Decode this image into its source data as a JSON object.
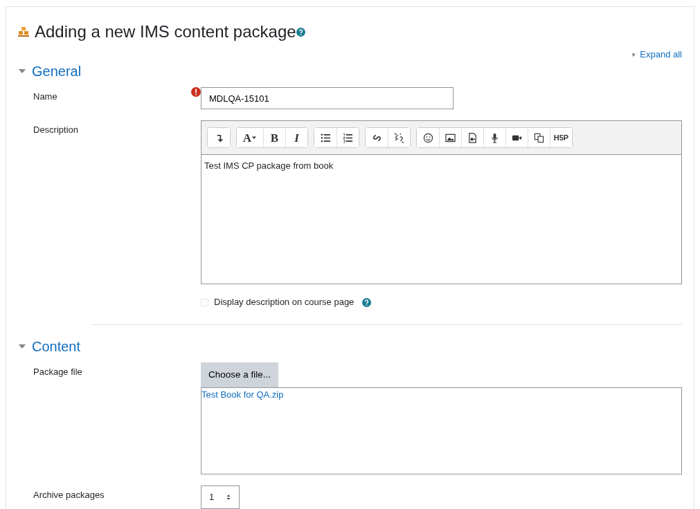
{
  "page": {
    "title": "Adding a new IMS content package",
    "expand_all": "Expand all"
  },
  "sections": [
    {
      "title": "General",
      "expanded": true,
      "fields": [
        {
          "kind": "text",
          "label": "Name",
          "required": true,
          "value": "MDLQA-15101"
        },
        {
          "kind": "editor",
          "label": "Description",
          "value": "Test IMS CP package from book",
          "toolbar": [
            [
              {
                "kind": "collapse"
              }
            ],
            [
              {
                "kind": "font",
                "text": "A"
              },
              {
                "kind": "bold",
                "text": "B"
              },
              {
                "kind": "italic",
                "text": "I"
              }
            ],
            [
              {
                "kind": "ul"
              },
              {
                "kind": "ol"
              }
            ],
            [
              {
                "kind": "link"
              },
              {
                "kind": "unlink"
              }
            ],
            [
              {
                "kind": "emoji"
              },
              {
                "kind": "image"
              },
              {
                "kind": "media"
              },
              {
                "kind": "mic"
              },
              {
                "kind": "video"
              },
              {
                "kind": "copy"
              },
              {
                "kind": "h5p",
                "text": "H5P"
              }
            ]
          ],
          "checkbox": {
            "label": "Display description on course page",
            "checked": false
          }
        }
      ]
    },
    {
      "title": "Content",
      "expanded": true,
      "fields": [
        {
          "kind": "file",
          "label": "Package file",
          "button": "Choose a file...",
          "files": [
            "Test Book for QA.zip"
          ]
        },
        {
          "kind": "select",
          "label": "Archive packages",
          "value": "1"
        }
      ]
    }
  ]
}
